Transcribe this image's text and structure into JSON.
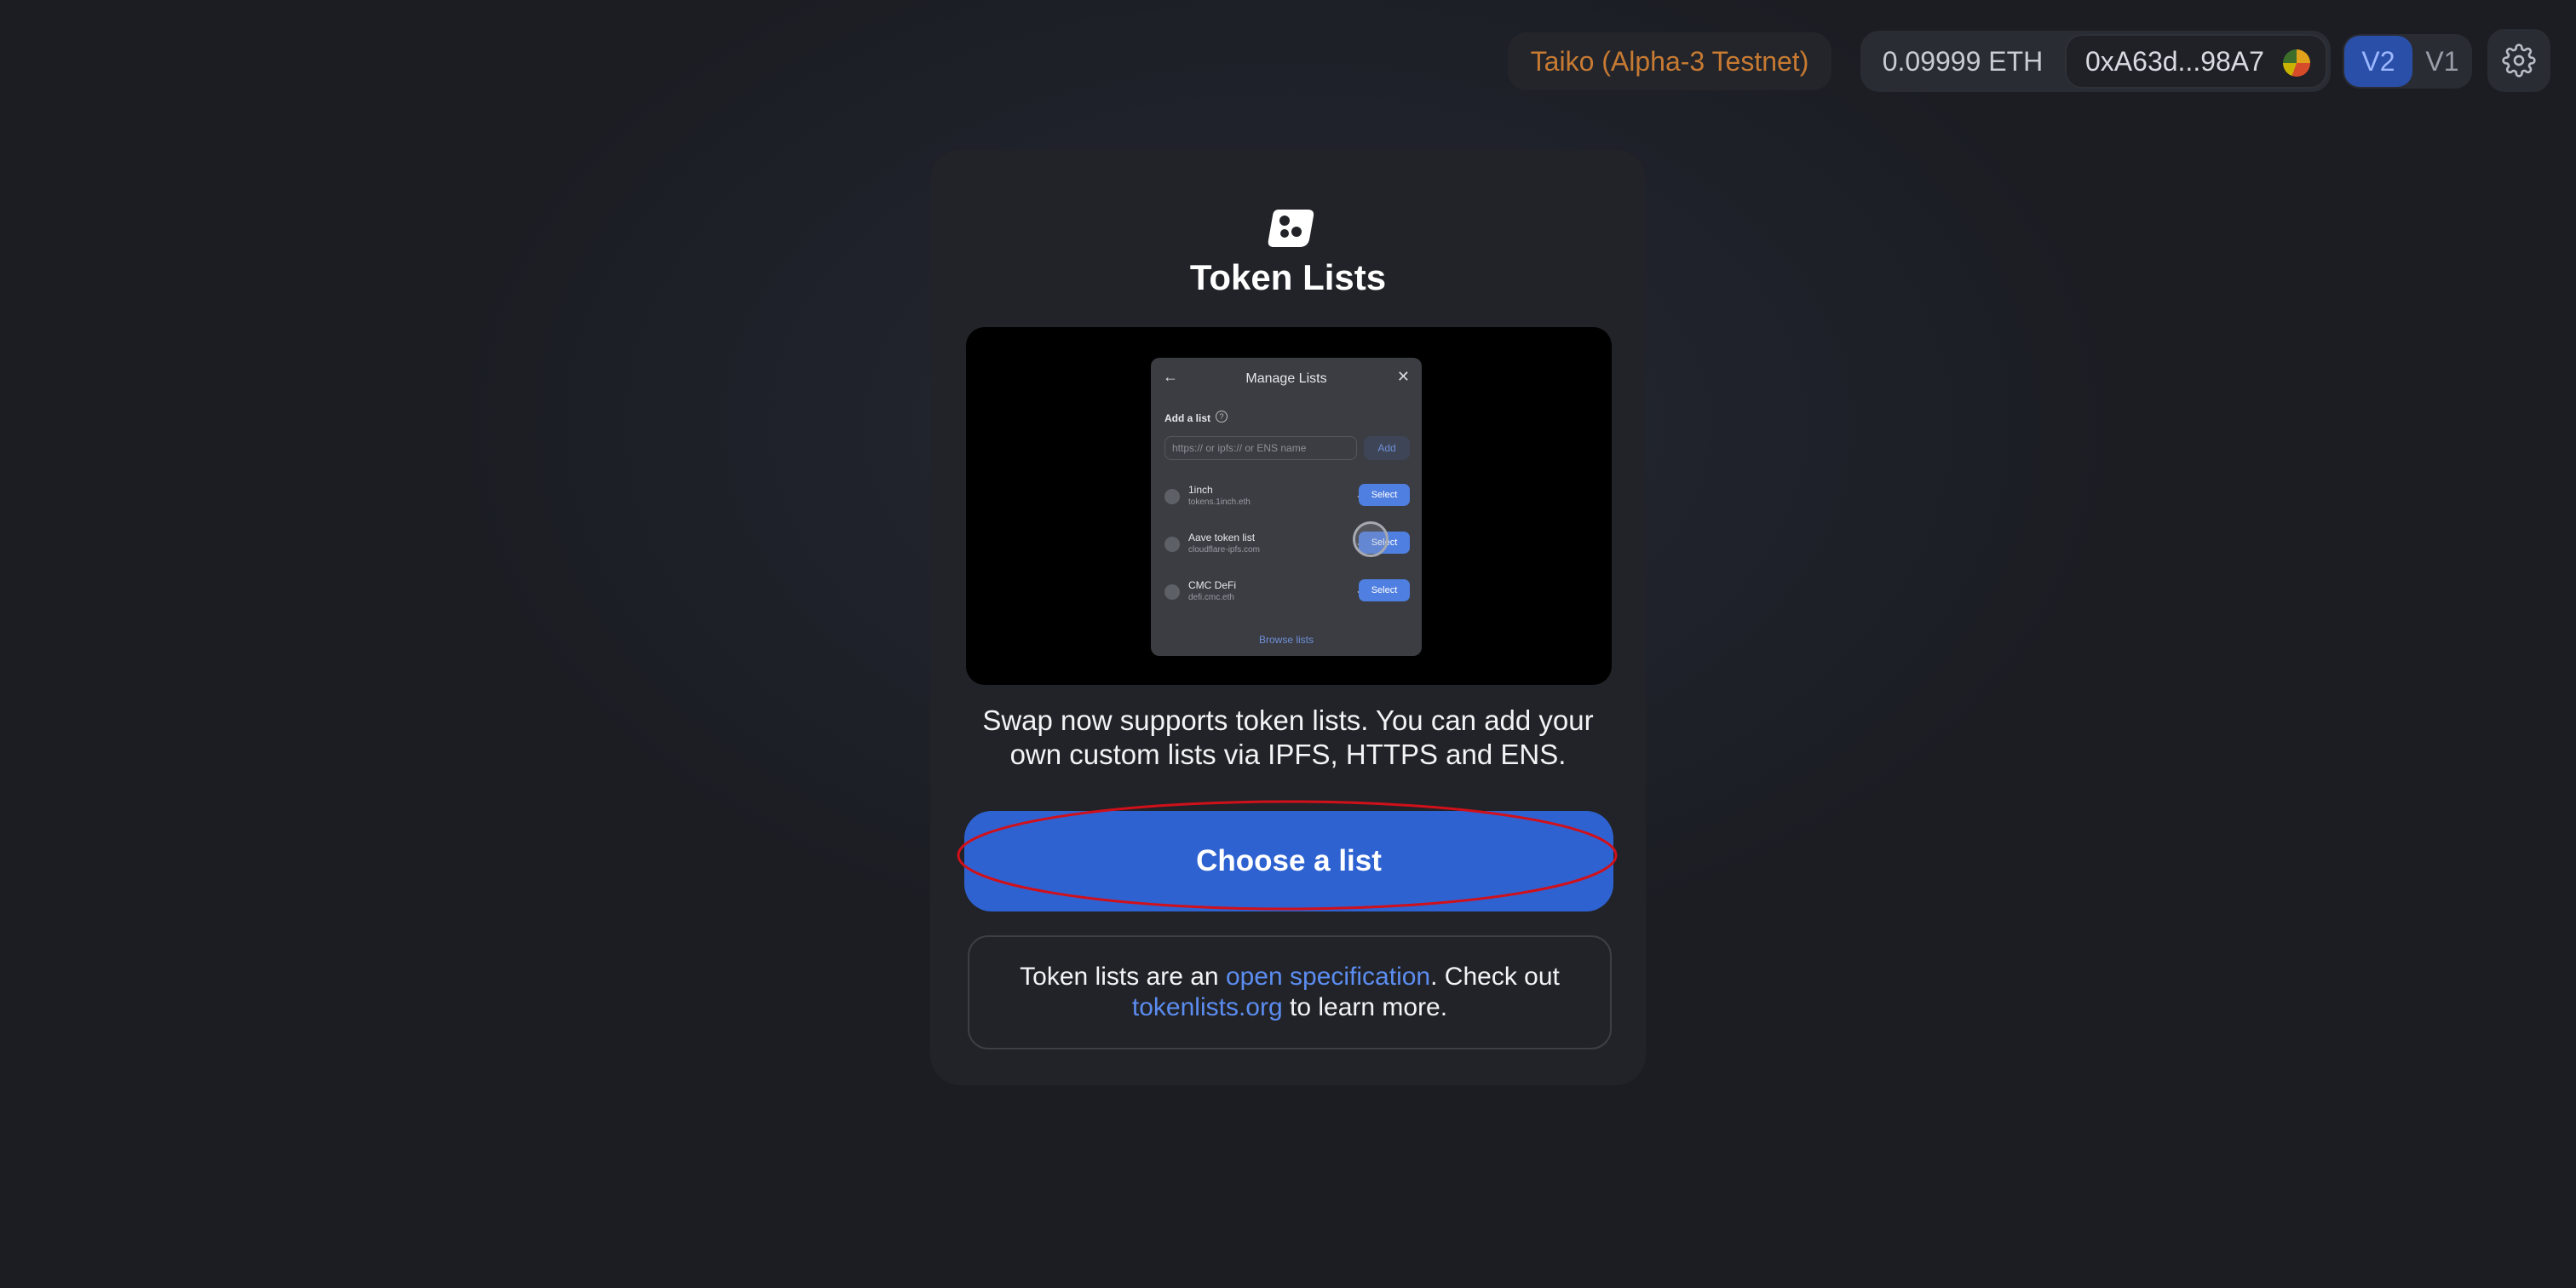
{
  "header": {
    "network_label": "Taiko (Alpha-3 Testnet)",
    "balance": "0.09999 ETH",
    "address": "0xA63d...98A7",
    "version_active": "V2",
    "version_other": "V1",
    "settings_icon": "gear-icon"
  },
  "card": {
    "title": "Token Lists",
    "logo_icon": "token-lists-icon",
    "description": "Swap now supports token lists. You can add your own custom lists via IPFS, HTTPS and ENS.",
    "primary_button": "Choose a list",
    "info": {
      "prefix": "Token lists are an ",
      "spec_link": "open specification",
      "middle": ". Check out ",
      "site_link": "tokenlists.org",
      "suffix": " to learn more."
    },
    "preview": {
      "title": "Manage Lists",
      "add_label": "Add a list",
      "input_placeholder": "https:// or ipfs:// or ENS name",
      "add_button": "Add",
      "lists": [
        {
          "name": "1inch",
          "source": "tokens.1inch.eth",
          "button": "Select"
        },
        {
          "name": "Aave token list",
          "source": "cloudflare-ipfs.com",
          "button": "Select"
        },
        {
          "name": "CMC DeFi",
          "source": "defi.cmc.eth",
          "button": "Select"
        }
      ],
      "browse": "Browse lists"
    }
  },
  "colors": {
    "accent": "#2f62d1",
    "network_text": "#c77a32",
    "link": "#5b8df0",
    "annotation": "#d0101a"
  }
}
